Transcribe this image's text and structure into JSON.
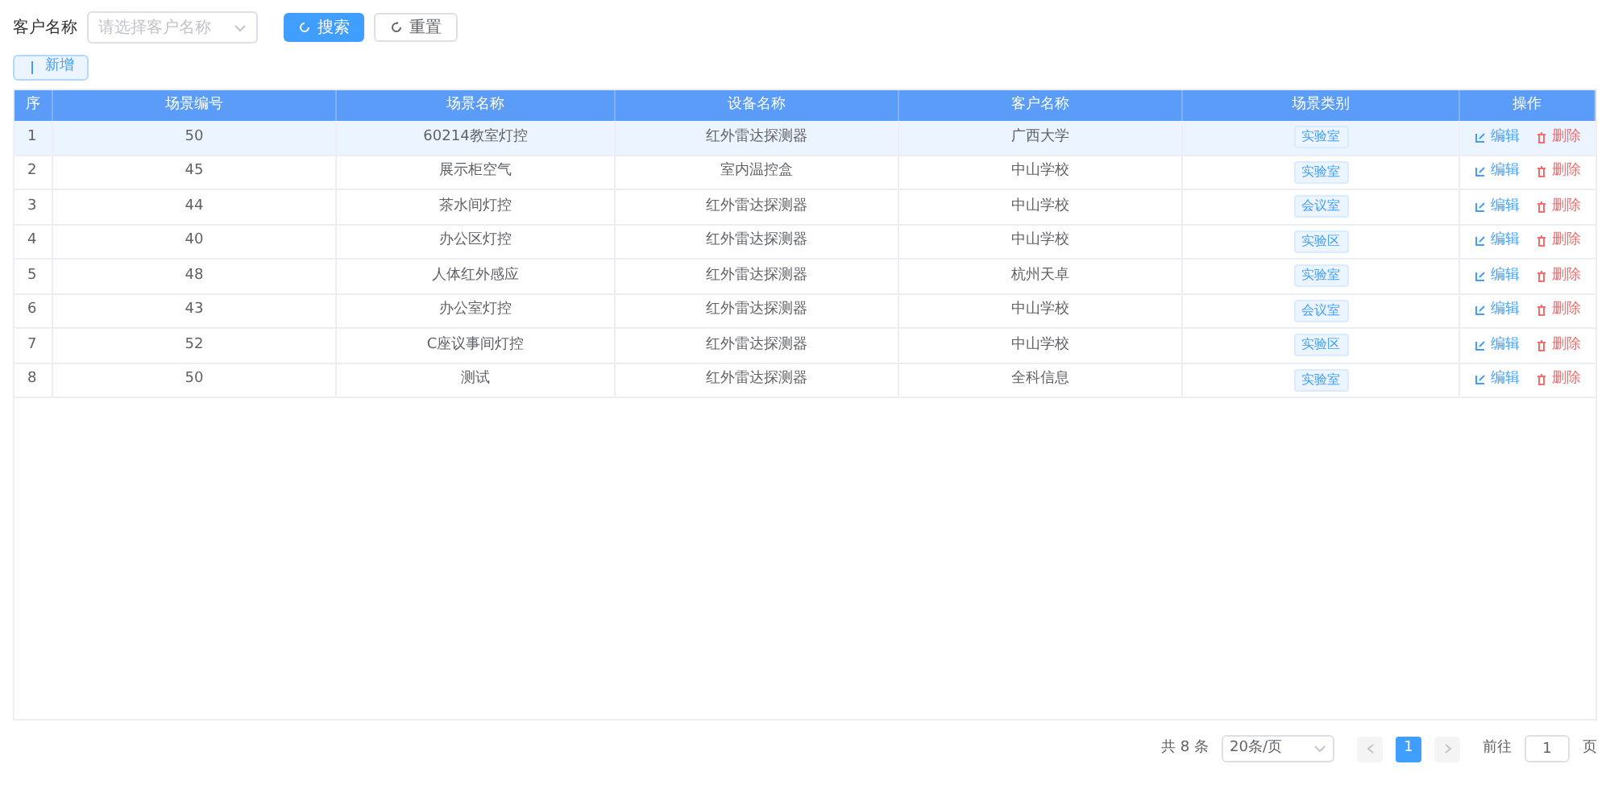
{
  "filter": {
    "label": "客户名称",
    "placeholder": "请选择客户名称",
    "search_button": "搜索",
    "reset_button": "重置"
  },
  "add_button": "新增",
  "table": {
    "columns": [
      "序",
      "场景编号",
      "场景名称",
      "设备名称",
      "客户名称",
      "场景类别",
      "操作"
    ],
    "rows": [
      {
        "cells": [
          "1",
          "50",
          "60214教室灯控",
          "红外雷达探测器",
          "广西大学"
        ],
        "tag": "实验室",
        "edit": "编辑",
        "delete": "删除",
        "selected": true
      },
      {
        "cells": [
          "2",
          "45",
          "展示柜空气",
          "室内温控盒",
          "中山学校"
        ],
        "tag": "实验室",
        "edit": "编辑",
        "delete": "删除",
        "selected": false
      },
      {
        "cells": [
          "3",
          "44",
          "茶水间灯控",
          "红外雷达探测器",
          "中山学校"
        ],
        "tag": "会议室",
        "edit": "编辑",
        "delete": "删除",
        "selected": false
      },
      {
        "cells": [
          "4",
          "40",
          "办公区灯控",
          "红外雷达探测器",
          "中山学校"
        ],
        "tag": "实验区",
        "edit": "编辑",
        "delete": "删除",
        "selected": false
      },
      {
        "cells": [
          "5",
          "48",
          "人体红外感应",
          "红外雷达探测器",
          "杭州天卓"
        ],
        "tag": "实验室",
        "edit": "编辑",
        "delete": "删除",
        "selected": false
      },
      {
        "cells": [
          "6",
          "43",
          "办公室灯控",
          "红外雷达探测器",
          "中山学校"
        ],
        "tag": "会议室",
        "edit": "编辑",
        "delete": "删除",
        "selected": false
      },
      {
        "cells": [
          "7",
          "52",
          "C座议事间灯控",
          "红外雷达探测器",
          "中山学校"
        ],
        "tag": "实验区",
        "edit": "编辑",
        "delete": "删除",
        "selected": false
      },
      {
        "cells": [
          "8",
          "50",
          "测试",
          "红外雷达探测器",
          "全科信息"
        ],
        "tag": "实验室",
        "edit": "编辑",
        "delete": "删除",
        "selected": false
      }
    ]
  },
  "pagination": {
    "total": "共 8 条",
    "page_size": "20条/页",
    "pages": [
      {
        "label": "1",
        "selected": true
      }
    ],
    "goto_label": "前往",
    "goto_value": "1",
    "page_unit": "页"
  }
}
